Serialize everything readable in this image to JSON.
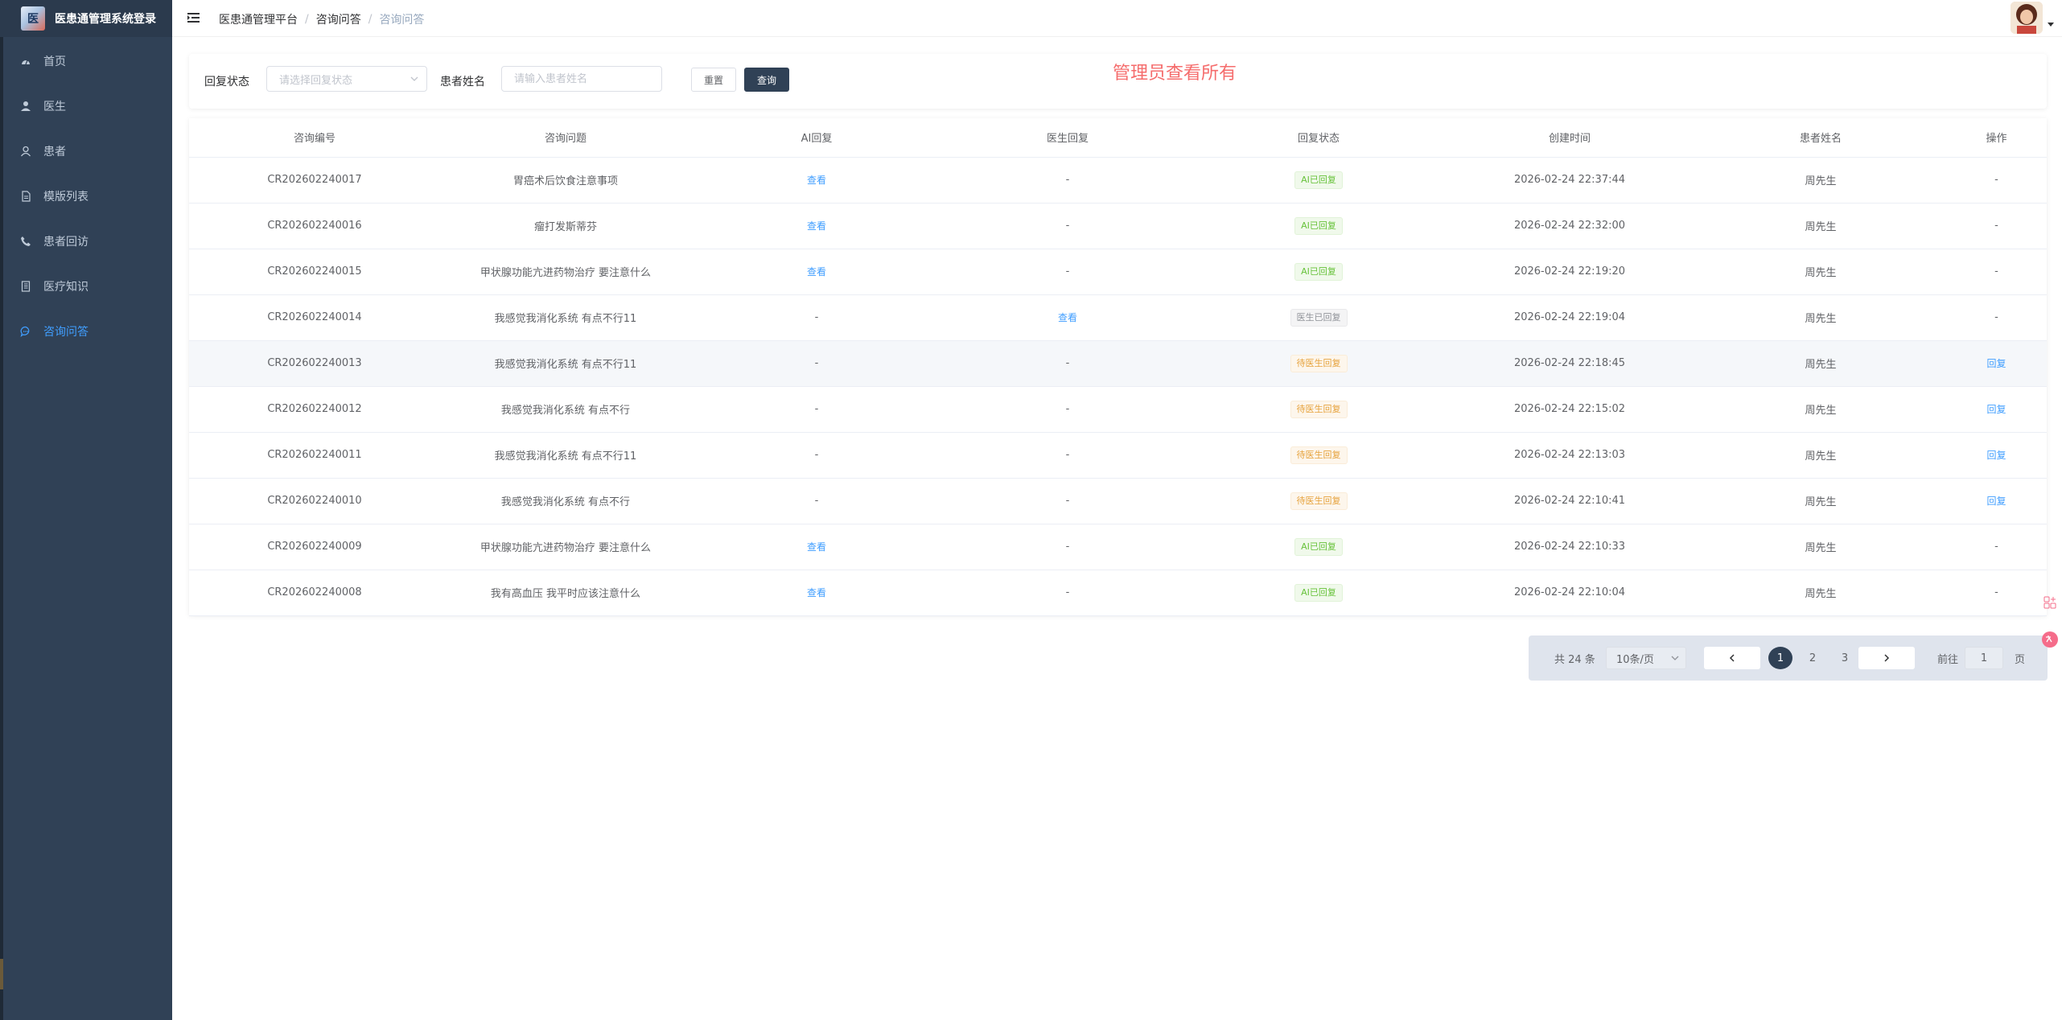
{
  "app": {
    "title": "医患通管理系统登录",
    "logo_text": "医"
  },
  "sidebar": {
    "items": [
      {
        "label": "首页",
        "icon": "dashboard-icon",
        "active": false
      },
      {
        "label": "医生",
        "icon": "user-solid-icon",
        "active": false
      },
      {
        "label": "患者",
        "icon": "user-icon",
        "active": false
      },
      {
        "label": "模版列表",
        "icon": "document-icon",
        "active": false
      },
      {
        "label": "患者回访",
        "icon": "phone-icon",
        "active": false
      },
      {
        "label": "医疗知识",
        "icon": "notebook-icon",
        "active": false
      },
      {
        "label": "咨询问答",
        "icon": "chat-icon",
        "active": true
      }
    ]
  },
  "breadcrumb": [
    "医患通管理平台",
    "咨询问答",
    "咨询问答"
  ],
  "search": {
    "status_label": "回复状态",
    "status_placeholder": "请选择回复状态",
    "name_label": "患者姓名",
    "name_placeholder": "请输入患者姓名",
    "reset_label": "重置",
    "query_label": "查询"
  },
  "admin_note": "管理员查看所有",
  "table": {
    "columns": [
      "咨询编号",
      "咨询问题",
      "AI回复",
      "医生回复",
      "回复状态",
      "创建时间",
      "患者姓名",
      "操作"
    ],
    "rows": [
      {
        "id": "CR202602240017",
        "question": "胃癌术后饮食注意事项",
        "ai": "查看",
        "doctor": "-",
        "status": "AI已回复",
        "status_type": "success",
        "time": "2026-02-24 22:37:44",
        "patient": "周先生",
        "action": "-"
      },
      {
        "id": "CR202602240016",
        "question": "瘤打发斯蒂芬",
        "ai": "查看",
        "doctor": "-",
        "status": "AI已回复",
        "status_type": "success",
        "time": "2026-02-24 22:32:00",
        "patient": "周先生",
        "action": "-"
      },
      {
        "id": "CR202602240015",
        "question": "甲状腺功能亢进药物治疗 要注意什么",
        "ai": "查看",
        "doctor": "-",
        "status": "AI已回复",
        "status_type": "success",
        "time": "2026-02-24 22:19:20",
        "patient": "周先生",
        "action": "-"
      },
      {
        "id": "CR202602240014",
        "question": "我感觉我消化系统 有点不行11",
        "ai": "-",
        "doctor": "查看",
        "status": "医生已回复",
        "status_type": "info",
        "time": "2026-02-24 22:19:04",
        "patient": "周先生",
        "action": "-"
      },
      {
        "id": "CR202602240013",
        "question": "我感觉我消化系统 有点不行11",
        "ai": "-",
        "doctor": "-",
        "status": "待医生回复",
        "status_type": "warning",
        "time": "2026-02-24 22:18:45",
        "patient": "周先生",
        "action": "回复"
      },
      {
        "id": "CR202602240012",
        "question": "我感觉我消化系统 有点不行",
        "ai": "-",
        "doctor": "-",
        "status": "待医生回复",
        "status_type": "warning",
        "time": "2026-02-24 22:15:02",
        "patient": "周先生",
        "action": "回复"
      },
      {
        "id": "CR202602240011",
        "question": "我感觉我消化系统 有点不行11",
        "ai": "-",
        "doctor": "-",
        "status": "待医生回复",
        "status_type": "warning",
        "time": "2026-02-24 22:13:03",
        "patient": "周先生",
        "action": "回复"
      },
      {
        "id": "CR202602240010",
        "question": "我感觉我消化系统 有点不行",
        "ai": "-",
        "doctor": "-",
        "status": "待医生回复",
        "status_type": "warning",
        "time": "2026-02-24 22:10:41",
        "patient": "周先生",
        "action": "回复"
      },
      {
        "id": "CR202602240009",
        "question": "甲状腺功能亢进药物治疗 要注意什么",
        "ai": "查看",
        "doctor": "-",
        "status": "AI已回复",
        "status_type": "success",
        "time": "2026-02-24 22:10:33",
        "patient": "周先生",
        "action": "-"
      },
      {
        "id": "CR202602240008",
        "question": "我有高血压 我平时应该注意什么",
        "ai": "查看",
        "doctor": "-",
        "status": "AI已回复",
        "status_type": "success",
        "time": "2026-02-24 22:10:04",
        "patient": "周先生",
        "action": "-"
      }
    ]
  },
  "pagination": {
    "total_text": "共 24 条",
    "page_size": "10条/页",
    "pages": [
      "1",
      "2",
      "3"
    ],
    "current": "1",
    "goto_label": "前往",
    "goto_value": "1",
    "page_suffix": "页"
  },
  "colors": {
    "sidebar_bg": "#304156",
    "active": "#409eff",
    "note": "#f56c6c",
    "primary_btn": "#304156"
  }
}
